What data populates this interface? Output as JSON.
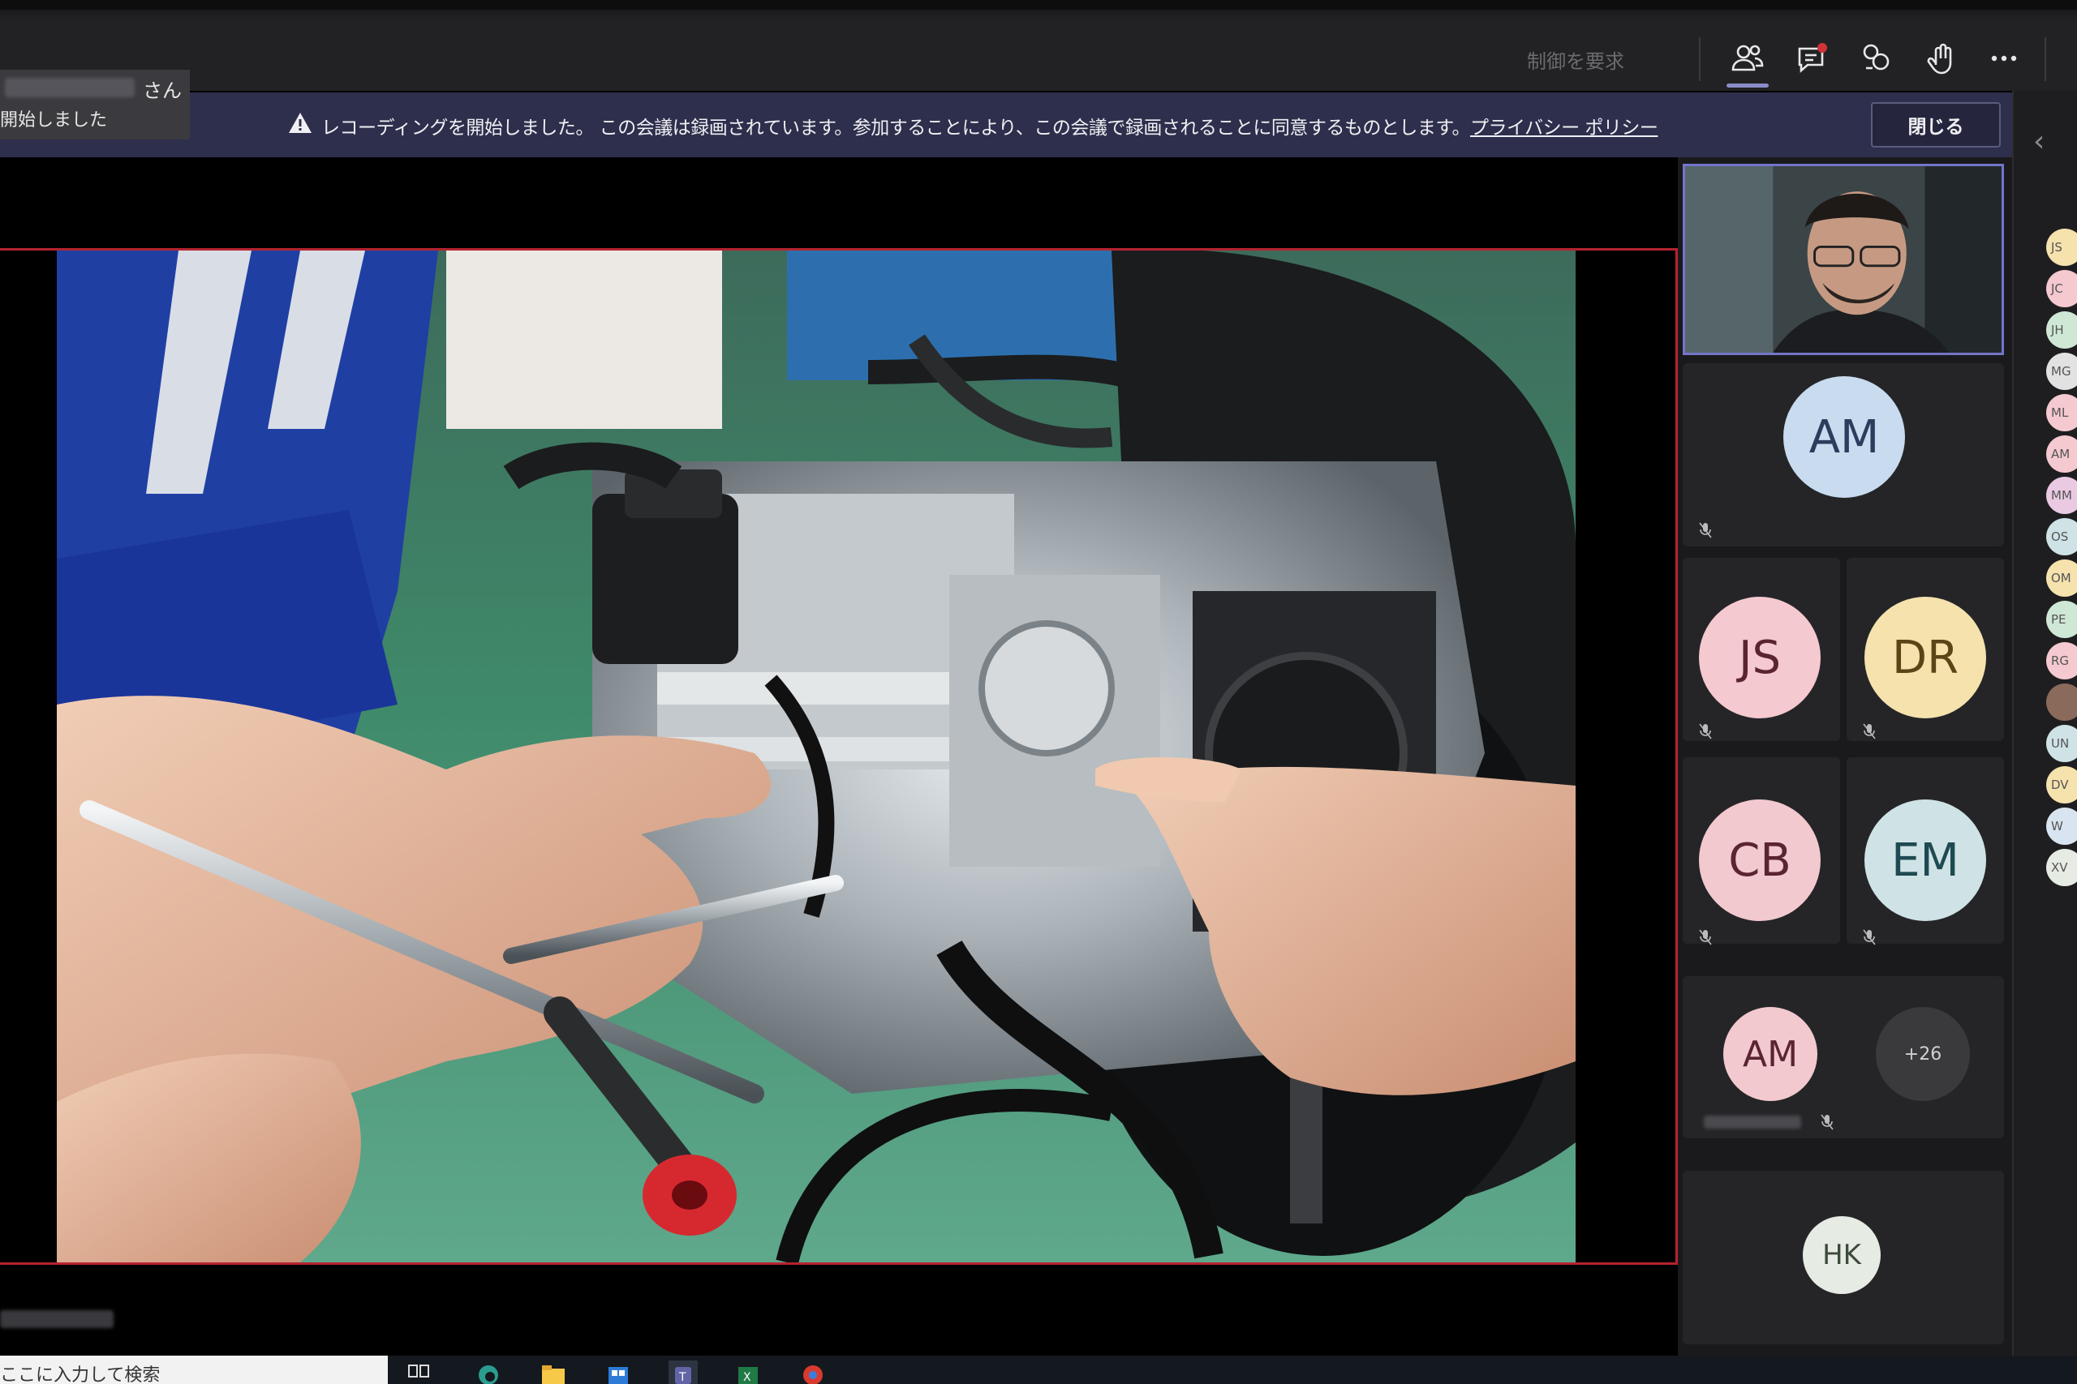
{
  "topbar": {
    "request_control": "制御を要求",
    "icons": [
      "participants-icon",
      "chat-icon",
      "breakout-rooms-icon",
      "raise-hand-icon",
      "more-options-icon"
    ]
  },
  "toast": {
    "suffix": "さん",
    "started": "開始しました"
  },
  "banner": {
    "message": "レコーディングを開始しました。 この会議は録画されています。参加することにより、この会議で録画されることに同意するものとします。",
    "privacy_link": "プライバシー ポリシー",
    "close_label": "閉じる"
  },
  "participants": {
    "tiles": [
      {
        "initials": "AM",
        "bg": "#c8dbef",
        "fg": "#2b3d5c"
      },
      {
        "initials": "JS",
        "bg": "#f4c9cf",
        "fg": "#5a2430"
      },
      {
        "initials": "DR",
        "bg": "#f5e2ad",
        "fg": "#5b4415"
      },
      {
        "initials": "CB",
        "bg": "#f2c9ce",
        "fg": "#5a2430"
      },
      {
        "initials": "EM",
        "bg": "#cfe3e6",
        "fg": "#1f4a52"
      },
      {
        "initials": "AM",
        "bg": "#f2c9ce",
        "fg": "#5a2430"
      },
      {
        "initials": "HK",
        "bg": "#e6ebe3",
        "fg": "#3c4a3a"
      }
    ],
    "overflow": "+26"
  },
  "roster": {
    "collapse_glyph": "‹",
    "avatars": [
      {
        "initials": "JS",
        "bg": "#f5e2ad"
      },
      {
        "initials": "JC",
        "bg": "#f4c9cf"
      },
      {
        "initials": "JH",
        "bg": "#cfe8d5"
      },
      {
        "initials": "MG",
        "bg": "#e2e2e2"
      },
      {
        "initials": "ML",
        "bg": "#f4c9cf"
      },
      {
        "initials": "AM",
        "bg": "#f4c9cf"
      },
      {
        "initials": "MM",
        "bg": "#eac9e2"
      },
      {
        "initials": "OS",
        "bg": "#cfe3e6"
      },
      {
        "initials": "OM",
        "bg": "#f5e2ad"
      },
      {
        "initials": "PE",
        "bg": "#cfe8d5"
      },
      {
        "initials": "RG",
        "bg": "#f4c9cf"
      },
      {
        "initials": "",
        "bg": "#8a6a5a"
      },
      {
        "initials": "UN",
        "bg": "#cfe3e6"
      },
      {
        "initials": "DV",
        "bg": "#f5e2ad"
      },
      {
        "initials": "W",
        "bg": "#d8e4f0"
      },
      {
        "initials": "XV",
        "bg": "#e6ebe3"
      }
    ]
  },
  "taskbar": {
    "search_text": "ここに入力して検索"
  }
}
